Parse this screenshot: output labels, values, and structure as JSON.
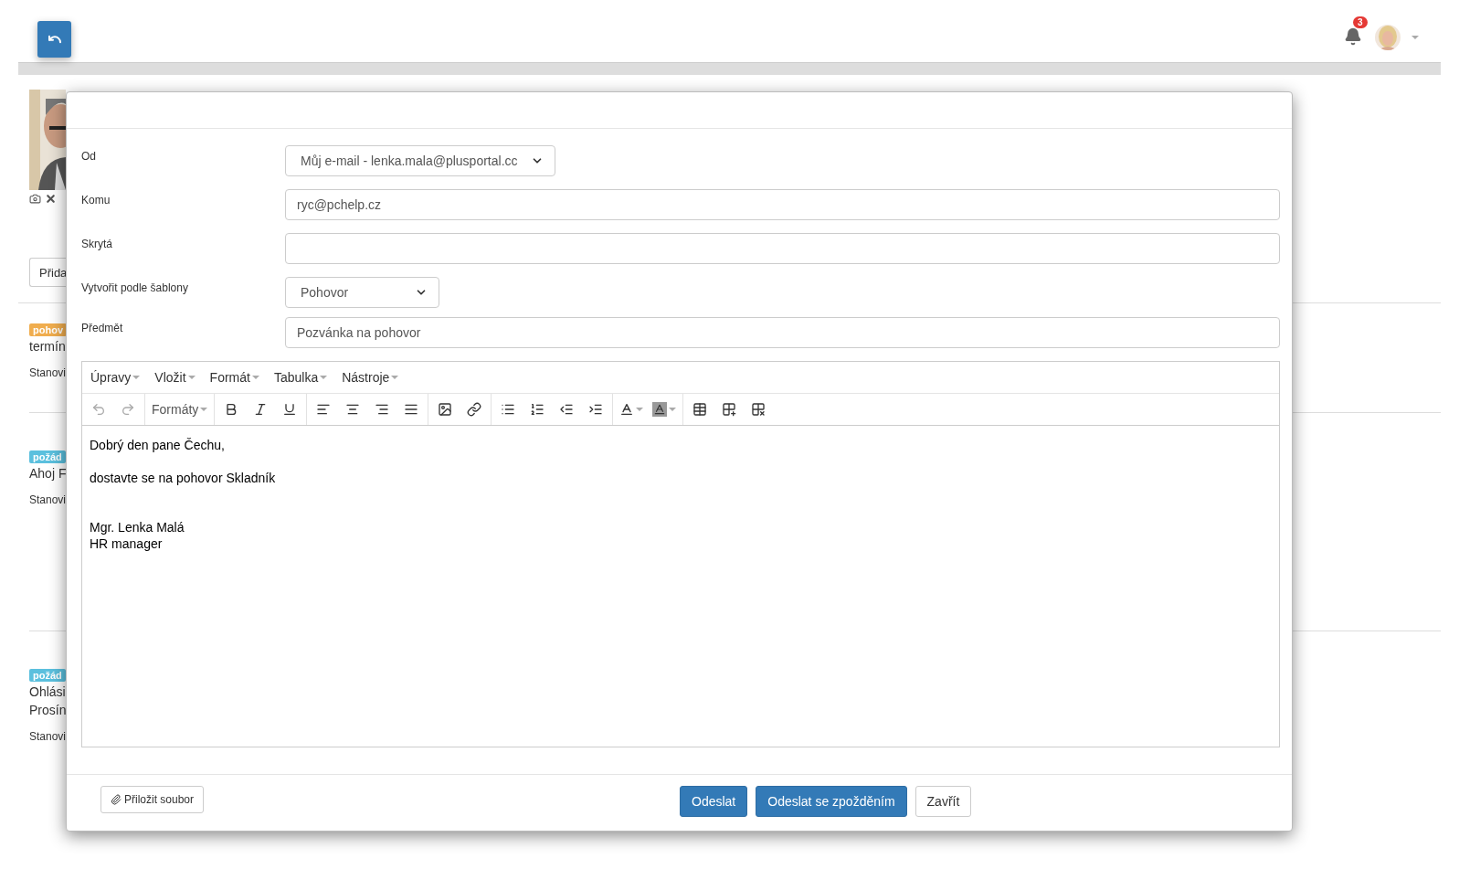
{
  "header": {
    "notifications": {
      "count": "3"
    }
  },
  "background": {
    "add_button": "Přida",
    "items": [
      {
        "tag": "pohov",
        "color": "#f0ad4e",
        "lines": [
          "termín"
        ],
        "meta": "Stanovi"
      },
      {
        "tag": "požád",
        "color": "#5bc0de",
        "lines": [
          "Ahoj F"
        ],
        "meta": "Stanovi"
      },
      {
        "tag": "požád",
        "color": "#5bc0de",
        "lines": [
          "Ohlási",
          "Prosín"
        ],
        "meta": "Stanovi"
      }
    ]
  },
  "dialog": {
    "fields": [
      {
        "label": "Od",
        "kind": "select",
        "value": "Můj e-mail - lenka.mala@plusportal.cc"
      },
      {
        "label": "Komu",
        "kind": "input",
        "value": "ryc@pchelp.cz"
      },
      {
        "label": "Skrytá",
        "kind": "input"
      },
      {
        "label": "Vytvořit podle šablony",
        "kind": "select",
        "value": "Pohovor"
      },
      {
        "label": "Předmět",
        "kind": "input",
        "value": "Pozvánka na pohovor"
      }
    ],
    "editor": {
      "menu": [
        "Úpravy",
        "Vložit",
        "Formát",
        "Tabulka",
        "Nástroje"
      ],
      "toolbar": {
        "undo": {
          "disabled": true
        },
        "redo": {
          "disabled": true
        },
        "formats": "Formáty"
      },
      "body": [
        {
          "kind": "paragraph",
          "lines": [
            "Dobrý den pane Čechu,"
          ]
        },
        {
          "kind": "paragraph",
          "lines": [
            "dostavte se na pohovor Skladník"
          ]
        },
        {
          "kind": "signature",
          "lines": [
            "Mgr. Lenka Malá",
            "HR manager"
          ]
        }
      ]
    },
    "attach_button": "Přiložit soubor",
    "buttons": [
      {
        "label": "Odeslat",
        "kind": "primary"
      },
      {
        "label": "Odeslat se zpožděním",
        "kind": "primary"
      },
      {
        "label": "Zavřít",
        "kind": "default"
      }
    ]
  }
}
